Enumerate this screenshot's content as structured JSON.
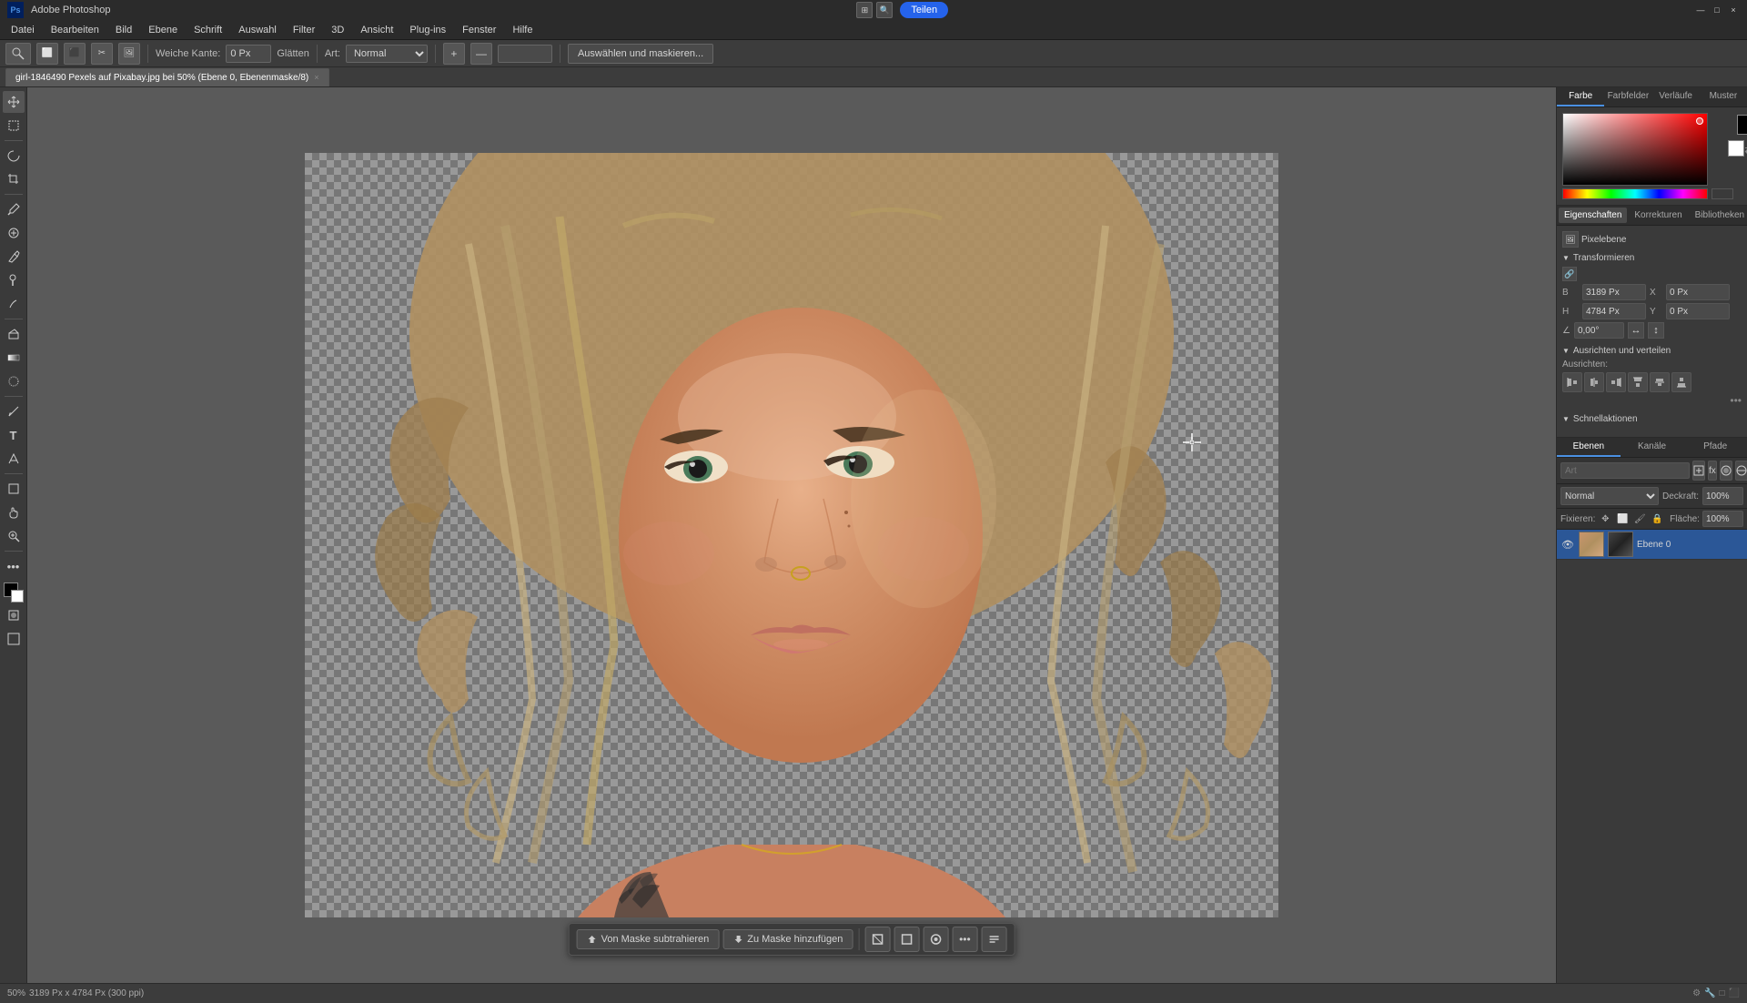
{
  "app": {
    "name": "Adobe Photoshop",
    "title_bar": "Adobe Photoshop"
  },
  "titlebar": {
    "logo_text": "Ps",
    "title": "Adobe Photoshop",
    "controls": [
      "—",
      "□",
      "×"
    ],
    "share_btn": "Teilen"
  },
  "menubar": {
    "items": [
      "Datei",
      "Bearbeiten",
      "Bild",
      "Ebene",
      "Schrift",
      "Auswahl",
      "Filter",
      "3D",
      "Ansicht",
      "Plug-ins",
      "Fenster",
      "Hilfe"
    ]
  },
  "toolbar": {
    "weiche_kante_label": "Weiche Kante:",
    "weiche_kante_value": "0 Px",
    "glatten_label": "Glätten",
    "art_label": "Art:",
    "art_value": "Normal",
    "select_mask_btn": "Auswählen und maskieren..."
  },
  "tab": {
    "filename": "girl-1846490 Pexels auf Pixabay.jpg bei 50% (Ebene 0, Ebenenmaske/8)",
    "close": "×"
  },
  "statusbar": {
    "zoom": "50%",
    "dimensions": "3189 Px x 4784 Px (300 ppi)"
  },
  "float_toolbar": {
    "subtract_btn": "Von Maske subtrahieren",
    "add_btn": "Zu Maske hinzufügen",
    "more_btn": "•••"
  },
  "right_panel": {
    "color_tabs": [
      "Farbe",
      "Farbfelder",
      "Verläufe",
      "Muster"
    ],
    "props_tabs": [
      "Eigenschaften",
      "Korrekturen",
      "Bibliotheken"
    ],
    "props_content": {
      "pixelebene_label": "Pixelebene",
      "transformieren_title": "Transformieren",
      "transform_b_label": "B",
      "transform_b_value": "3189 Px",
      "transform_x_label": "X",
      "transform_x_value": "0 Px",
      "transform_h_label": "H",
      "transform_h_value": "4784 Px",
      "transform_y_label": "Y",
      "transform_y_value": "0 Px",
      "transform_angle_value": "0,00°",
      "ausrichten_title": "Ausrichten und verteilen",
      "ausrichten_label": "Ausrichten:",
      "schnellaktionen_title": "Schnellaktionen"
    },
    "layers_tabs": [
      "Ebenen",
      "Kanäle",
      "Pfade"
    ],
    "layers_blend": {
      "mode": "Normal",
      "deckraft_label": "Deckraft:",
      "deckraft_value": "100%",
      "fixieren_label": "Fixieren:",
      "flache_label": "Fläche:",
      "flache_value": "100%"
    },
    "layers": [
      {
        "name": "Ebene 0",
        "visible": true,
        "selected": true
      }
    ],
    "search_placeholder": "Art"
  }
}
